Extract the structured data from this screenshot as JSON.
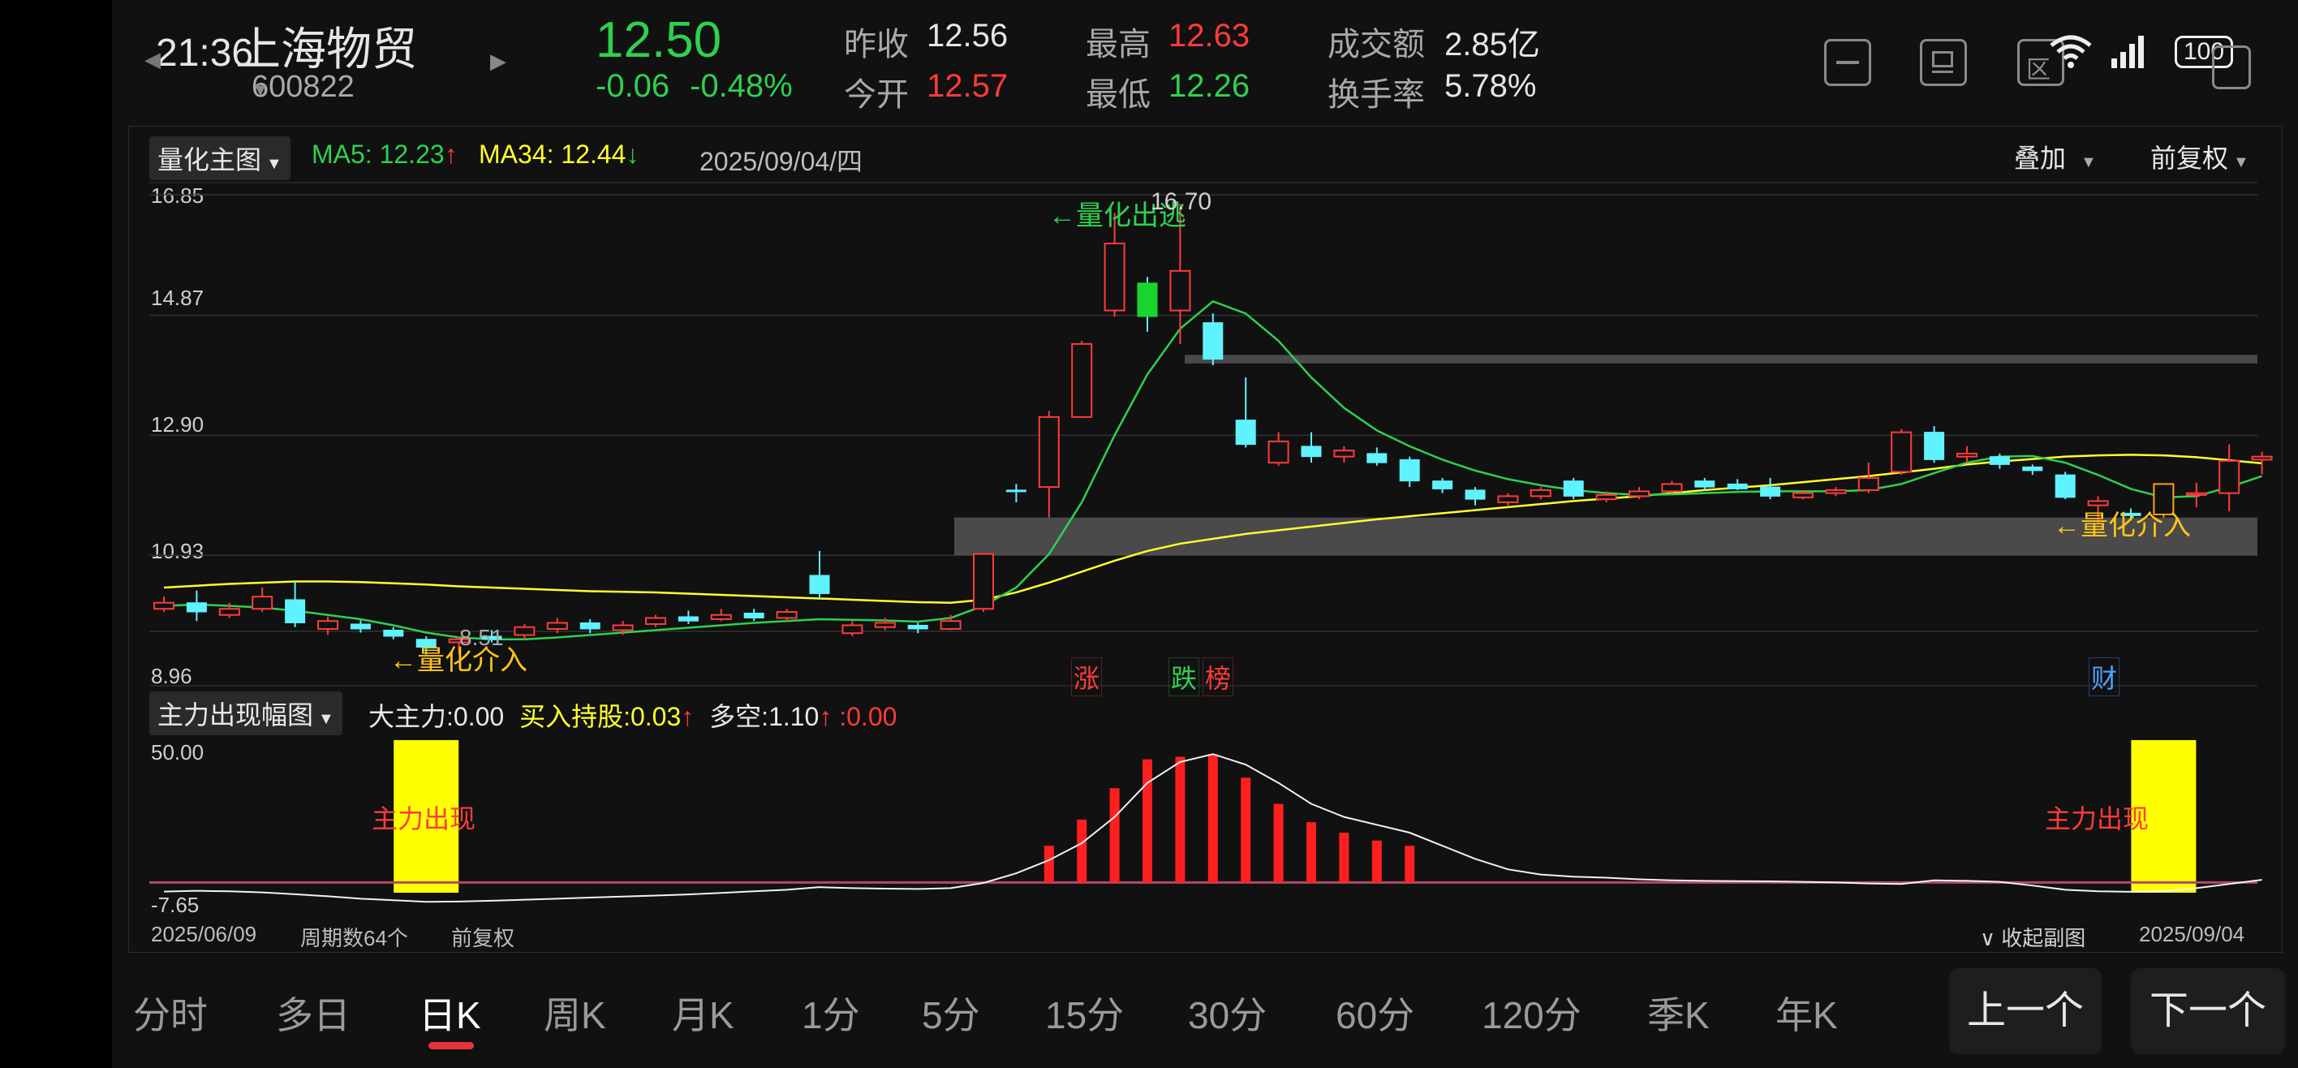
{
  "status": {
    "time": "21:36",
    "battery": "100"
  },
  "stock": {
    "name": "上海物贸",
    "code": "600822",
    "price": "12.50",
    "change": "-0.06",
    "change_pct": "-0.48%",
    "prev_close_label": "昨收",
    "prev_close": "12.56",
    "open_label": "今开",
    "open": "12.57",
    "high_label": "最高",
    "high": "12.63",
    "low_label": "最低",
    "low": "12.26",
    "turnover_label": "成交额",
    "turnover": "2.85亿",
    "turnover_rate_label": "换手率",
    "turnover_rate": "5.78%"
  },
  "main_chart": {
    "indicator": "量化主图",
    "ma5_label": "MA5: 12.23",
    "ma5_arrow": "↑",
    "ma34_label": "MA34: 12.44",
    "ma34_arrow": "↓",
    "date": "2025/09/04/四",
    "overlay": "叠加",
    "adjust": "前复权",
    "ylabels": [
      "16.85",
      "14.87",
      "12.90",
      "10.93",
      "8.96"
    ],
    "annotations": {
      "exit": "←量化出逃",
      "entry1": "←量化介入",
      "entry2": "←量化介入",
      "high_price": "16.70",
      "low_price": "8.51"
    },
    "event_labels": [
      "涨",
      "跌",
      "榜",
      "财"
    ]
  },
  "sub_chart": {
    "indicator": "主力出现幅图",
    "big_label": "大主力:",
    "big_value": "0.00",
    "buy_label": "买入持股:",
    "buy_value": "0.03",
    "buy_arrow": "↑",
    "ls_label": "多空:",
    "ls_value": "1.10",
    "ls_arrow": "↑",
    "tail": " :0.00",
    "ylabels": [
      "50.00",
      "-7.65"
    ],
    "signal": "主力出现"
  },
  "footer": {
    "start_date": "2025/06/09",
    "period": "周期数64个",
    "adjust": "前复权",
    "collapse": "收起副图",
    "end_date": "2025/09/04"
  },
  "tabs": [
    "分时",
    "多日",
    "日K",
    "周K",
    "月K",
    "1分",
    "5分",
    "15分",
    "30分",
    "60分",
    "120分",
    "季K",
    "年K"
  ],
  "active_tab": "日K",
  "nav": {
    "prev": "上一个",
    "next": "下一个"
  },
  "colors": {
    "up": "#ff3b3b",
    "down": "#2fd04f",
    "cyan": "#5ff2ff",
    "ma5": "#2fd04f",
    "ma34": "#ffff2e",
    "signal": "#ffff00"
  },
  "chart_data": {
    "type": "candlestick",
    "price_range": [
      8.96,
      16.85
    ],
    "candles": [
      {
        "o": 10.05,
        "c": 10.15,
        "h": 10.25,
        "l": 10.0
      },
      {
        "o": 10.15,
        "c": 10.0,
        "h": 10.35,
        "l": 9.85
      },
      {
        "o": 9.95,
        "c": 10.05,
        "h": 10.15,
        "l": 9.9
      },
      {
        "o": 10.05,
        "c": 10.25,
        "h": 10.4,
        "l": 10.0
      },
      {
        "o": 10.2,
        "c": 9.82,
        "h": 10.5,
        "l": 9.75
      },
      {
        "o": 9.72,
        "c": 9.85,
        "h": 9.92,
        "l": 9.62
      },
      {
        "o": 9.8,
        "c": 9.72,
        "h": 9.86,
        "l": 9.66
      },
      {
        "o": 9.7,
        "c": 9.6,
        "h": 9.75,
        "l": 9.55
      },
      {
        "o": 9.55,
        "c": 9.42,
        "h": 9.6,
        "l": 9.3
      },
      {
        "o": 9.5,
        "c": 9.55,
        "h": 9.6,
        "l": 9.3
      },
      {
        "o": 9.6,
        "c": 9.55,
        "h": 9.7,
        "l": 9.5
      },
      {
        "o": 9.62,
        "c": 9.75,
        "h": 9.8,
        "l": 9.55
      },
      {
        "o": 9.72,
        "c": 9.82,
        "h": 9.9,
        "l": 9.65
      },
      {
        "o": 9.82,
        "c": 9.72,
        "h": 9.88,
        "l": 9.65
      },
      {
        "o": 9.7,
        "c": 9.78,
        "h": 9.85,
        "l": 9.62
      },
      {
        "o": 9.8,
        "c": 9.9,
        "h": 9.95,
        "l": 9.75
      },
      {
        "o": 9.92,
        "c": 9.85,
        "h": 10.02,
        "l": 9.8
      },
      {
        "o": 9.88,
        "c": 9.95,
        "h": 10.05,
        "l": 9.85
      },
      {
        "o": 9.98,
        "c": 9.9,
        "h": 10.05,
        "l": 9.85
      },
      {
        "o": 9.9,
        "c": 10.0,
        "h": 10.05,
        "l": 9.85
      },
      {
        "o": 10.6,
        "c": 10.3,
        "h": 11.0,
        "l": 10.2
      },
      {
        "o": 9.65,
        "c": 9.78,
        "h": 9.85,
        "l": 9.6
      },
      {
        "o": 9.75,
        "c": 9.82,
        "h": 9.9,
        "l": 9.7
      },
      {
        "o": 9.78,
        "c": 9.72,
        "h": 9.82,
        "l": 9.65
      },
      {
        "o": 9.72,
        "c": 9.85,
        "h": 9.95,
        "l": 9.7
      },
      {
        "o": 10.05,
        "c": 10.95,
        "h": 10.95,
        "l": 10.0
      },
      {
        "o": 12.0,
        "c": 12.0,
        "h": 12.1,
        "l": 11.8
      },
      {
        "o": 12.05,
        "c": 13.2,
        "h": 13.3,
        "l": 11.55
      },
      {
        "o": 13.2,
        "c": 14.4,
        "h": 14.45,
        "l": 13.25
      },
      {
        "o": 14.95,
        "c": 16.05,
        "h": 16.55,
        "l": 14.85
      },
      {
        "o": 15.4,
        "c": 14.85,
        "h": 15.5,
        "l": 14.6
      },
      {
        "o": 14.95,
        "c": 15.6,
        "h": 16.7,
        "l": 14.4
      },
      {
        "o": 14.75,
        "c": 14.15,
        "h": 14.9,
        "l": 14.05
      },
      {
        "o": 13.15,
        "c": 12.75,
        "h": 13.85,
        "l": 12.7
      },
      {
        "o": 12.45,
        "c": 12.8,
        "h": 12.95,
        "l": 12.4
      },
      {
        "o": 12.72,
        "c": 12.55,
        "h": 12.95,
        "l": 12.45
      },
      {
        "o": 12.55,
        "c": 12.65,
        "h": 12.72,
        "l": 12.45
      },
      {
        "o": 12.6,
        "c": 12.45,
        "h": 12.7,
        "l": 12.4
      },
      {
        "o": 12.5,
        "c": 12.15,
        "h": 12.55,
        "l": 12.05
      },
      {
        "o": 12.15,
        "c": 12.02,
        "h": 12.2,
        "l": 11.95
      },
      {
        "o": 12.0,
        "c": 11.85,
        "h": 12.05,
        "l": 11.75
      },
      {
        "o": 11.8,
        "c": 11.9,
        "h": 11.95,
        "l": 11.75
      },
      {
        "o": 11.9,
        "c": 12.0,
        "h": 12.05,
        "l": 11.85
      },
      {
        "o": 12.15,
        "c": 11.9,
        "h": 12.2,
        "l": 11.85
      },
      {
        "o": 11.85,
        "c": 11.92,
        "h": 11.98,
        "l": 11.8
      },
      {
        "o": 11.9,
        "c": 11.98,
        "h": 12.05,
        "l": 11.85
      },
      {
        "o": 11.98,
        "c": 12.1,
        "h": 12.15,
        "l": 11.95
      },
      {
        "o": 12.15,
        "c": 12.05,
        "h": 12.2,
        "l": 12.0
      },
      {
        "o": 12.1,
        "c": 12.02,
        "h": 12.18,
        "l": 12.0
      },
      {
        "o": 12.05,
        "c": 11.9,
        "h": 12.2,
        "l": 11.85
      },
      {
        "o": 11.88,
        "c": 11.95,
        "h": 12.0,
        "l": 11.85
      },
      {
        "o": 11.95,
        "c": 12.0,
        "h": 12.05,
        "l": 11.9
      },
      {
        "o": 12.0,
        "c": 12.2,
        "h": 12.45,
        "l": 11.95
      },
      {
        "o": 12.3,
        "c": 12.95,
        "h": 13.0,
        "l": 12.25
      },
      {
        "o": 12.95,
        "c": 12.5,
        "h": 13.05,
        "l": 12.45
      },
      {
        "o": 12.55,
        "c": 12.6,
        "h": 12.72,
        "l": 12.45
      },
      {
        "o": 12.55,
        "c": 12.42,
        "h": 12.6,
        "l": 12.35
      },
      {
        "o": 12.38,
        "c": 12.32,
        "h": 12.42,
        "l": 12.25
      },
      {
        "o": 12.25,
        "c": 11.88,
        "h": 12.3,
        "l": 11.85
      },
      {
        "o": 11.75,
        "c": 11.82,
        "h": 11.9,
        "l": 11.45
      },
      {
        "o": 11.62,
        "c": 11.58,
        "h": 11.7,
        "l": 11.5
      },
      {
        "o": 11.6,
        "c": 12.1,
        "h": 12.1,
        "l": 11.55
      },
      {
        "o": 11.92,
        "c": 11.95,
        "h": 12.12,
        "l": 11.72
      },
      {
        "o": 11.95,
        "c": 12.48,
        "h": 12.75,
        "l": 11.65
      },
      {
        "o": 12.5,
        "c": 12.55,
        "h": 12.63,
        "l": 12.26
      }
    ],
    "special_colors": {
      "61": "orange"
    },
    "ma5": [
      10.1,
      10.12,
      10.1,
      10.07,
      10.02,
      9.95,
      9.88,
      9.78,
      9.66,
      9.58,
      9.55,
      9.55,
      9.58,
      9.62,
      9.66,
      9.7,
      9.74,
      9.78,
      9.82,
      9.85,
      9.88,
      9.87,
      9.86,
      9.84,
      9.9,
      10.1,
      10.4,
      10.95,
      11.8,
      12.9,
      13.9,
      14.65,
      15.1,
      14.9,
      14.45,
      13.85,
      13.35,
      12.98,
      12.72,
      12.5,
      12.32,
      12.18,
      12.08,
      12.0,
      11.95,
      11.92,
      11.93,
      11.95,
      11.97,
      11.98,
      11.98,
      11.98,
      12.0,
      12.1,
      12.28,
      12.45,
      12.55,
      12.56,
      12.45,
      12.25,
      12.02,
      11.88,
      11.9,
      12.05,
      12.23
    ],
    "ma34": [
      10.4,
      10.43,
      10.46,
      10.48,
      10.5,
      10.5,
      10.49,
      10.47,
      10.45,
      10.42,
      10.4,
      10.38,
      10.36,
      10.34,
      10.33,
      10.32,
      10.3,
      10.28,
      10.26,
      10.24,
      10.22,
      10.2,
      10.18,
      10.16,
      10.15,
      10.2,
      10.32,
      10.48,
      10.66,
      10.84,
      11.0,
      11.12,
      11.2,
      11.28,
      11.34,
      11.4,
      11.46,
      11.52,
      11.57,
      11.62,
      11.67,
      11.72,
      11.77,
      11.82,
      11.86,
      11.9,
      11.95,
      12.0,
      12.04,
      12.08,
      12.13,
      12.18,
      12.23,
      12.29,
      12.35,
      12.42,
      12.47,
      12.51,
      12.55,
      12.57,
      12.58,
      12.57,
      12.54,
      12.49,
      12.44
    ],
    "bands": [
      {
        "top": 14.22,
        "bottom": 14.08
      },
      {
        "top": 11.55,
        "bottom": 10.93
      }
    ],
    "sub": {
      "range": [
        -7.65,
        50.0
      ],
      "signal_candles": [
        8,
        61
      ],
      "bars": [
        0,
        0,
        0,
        0,
        0,
        0,
        0,
        0,
        0,
        0,
        0,
        0,
        0,
        0,
        0,
        0,
        0,
        0,
        0,
        0,
        0,
        0,
        0,
        0,
        0,
        0,
        0,
        14,
        24,
        36,
        47,
        48,
        49,
        40,
        30,
        23,
        19,
        16,
        14,
        0,
        0,
        0,
        0,
        0,
        0,
        0,
        0,
        0,
        0,
        0,
        0,
        0,
        0,
        0,
        0,
        0,
        0,
        0,
        0,
        0,
        0,
        0,
        0,
        0,
        0
      ],
      "line": [
        -3.5,
        -3.2,
        -3.4,
        -3.8,
        -4.5,
        -5.3,
        -6.2,
        -6.8,
        -7.4,
        -7.3,
        -7.0,
        -6.6,
        -6.2,
        -5.8,
        -5.4,
        -5.0,
        -4.6,
        -4.0,
        -3.4,
        -2.8,
        -1.8,
        -2.2,
        -2.4,
        -2.5,
        -2.2,
        -0.2,
        3.5,
        8.5,
        15,
        25,
        38,
        46,
        49,
        45,
        38,
        30,
        25,
        22,
        19,
        14,
        9,
        5,
        3,
        2.2,
        1.8,
        1.2,
        0.8,
        0.6,
        0.5,
        0.4,
        0.2,
        0,
        -0.4,
        -0.6,
        0.8,
        0.6,
        0.2,
        -1.2,
        -2.8,
        -3.4,
        -3.6,
        -3.4,
        -2.2,
        -0.6,
        1.0
      ]
    }
  }
}
